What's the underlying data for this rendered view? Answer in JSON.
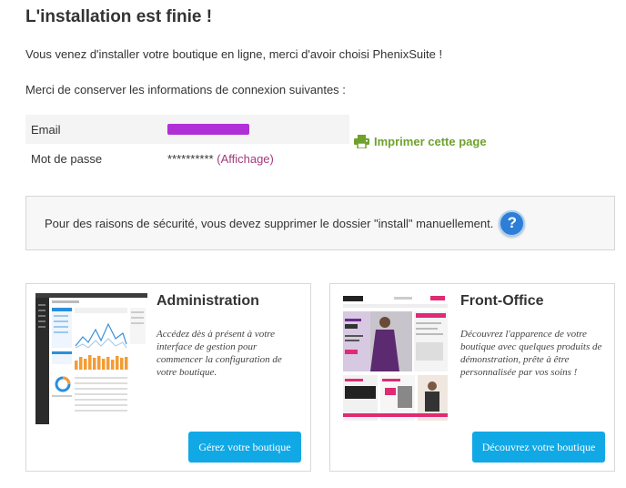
{
  "title": "L'installation est finie !",
  "intro": "Vous venez d'installer votre boutique en ligne, merci d'avoir choisi PhenixSuite !",
  "keep_info": "Merci de conserver les informations de connexion suivantes :",
  "credentials": {
    "email_label": "Email",
    "password_label": "Mot de passe",
    "password_value": "**********",
    "show_open": "(",
    "show_link": "Affichage",
    "show_close": ")"
  },
  "print_label": "Imprimer cette page",
  "security_notice": "Pour des raisons de sécurité, vous devez supprimer le dossier \"install\" manuellement.",
  "help_symbol": "?",
  "cards": {
    "admin": {
      "title": "Administration",
      "description": "Accédez dès à présent à votre interface de gestion pour commencer la configuration de votre boutique.",
      "button": "Gérez votre boutique"
    },
    "front": {
      "title": "Front-Office",
      "description": "Découvrez l'apparence de votre boutique avec quelques produits de démonstration, prête à être personnalisée par vos soins !",
      "button": "Découvrez votre boutique"
    }
  },
  "colors": {
    "accent_green": "#6fa12d",
    "button_blue": "#10a9e6",
    "link": "#a43a7a",
    "help_blue": "#2d7ed6"
  },
  "icons": {
    "print": "printer-icon",
    "help": "question-mark-icon"
  }
}
